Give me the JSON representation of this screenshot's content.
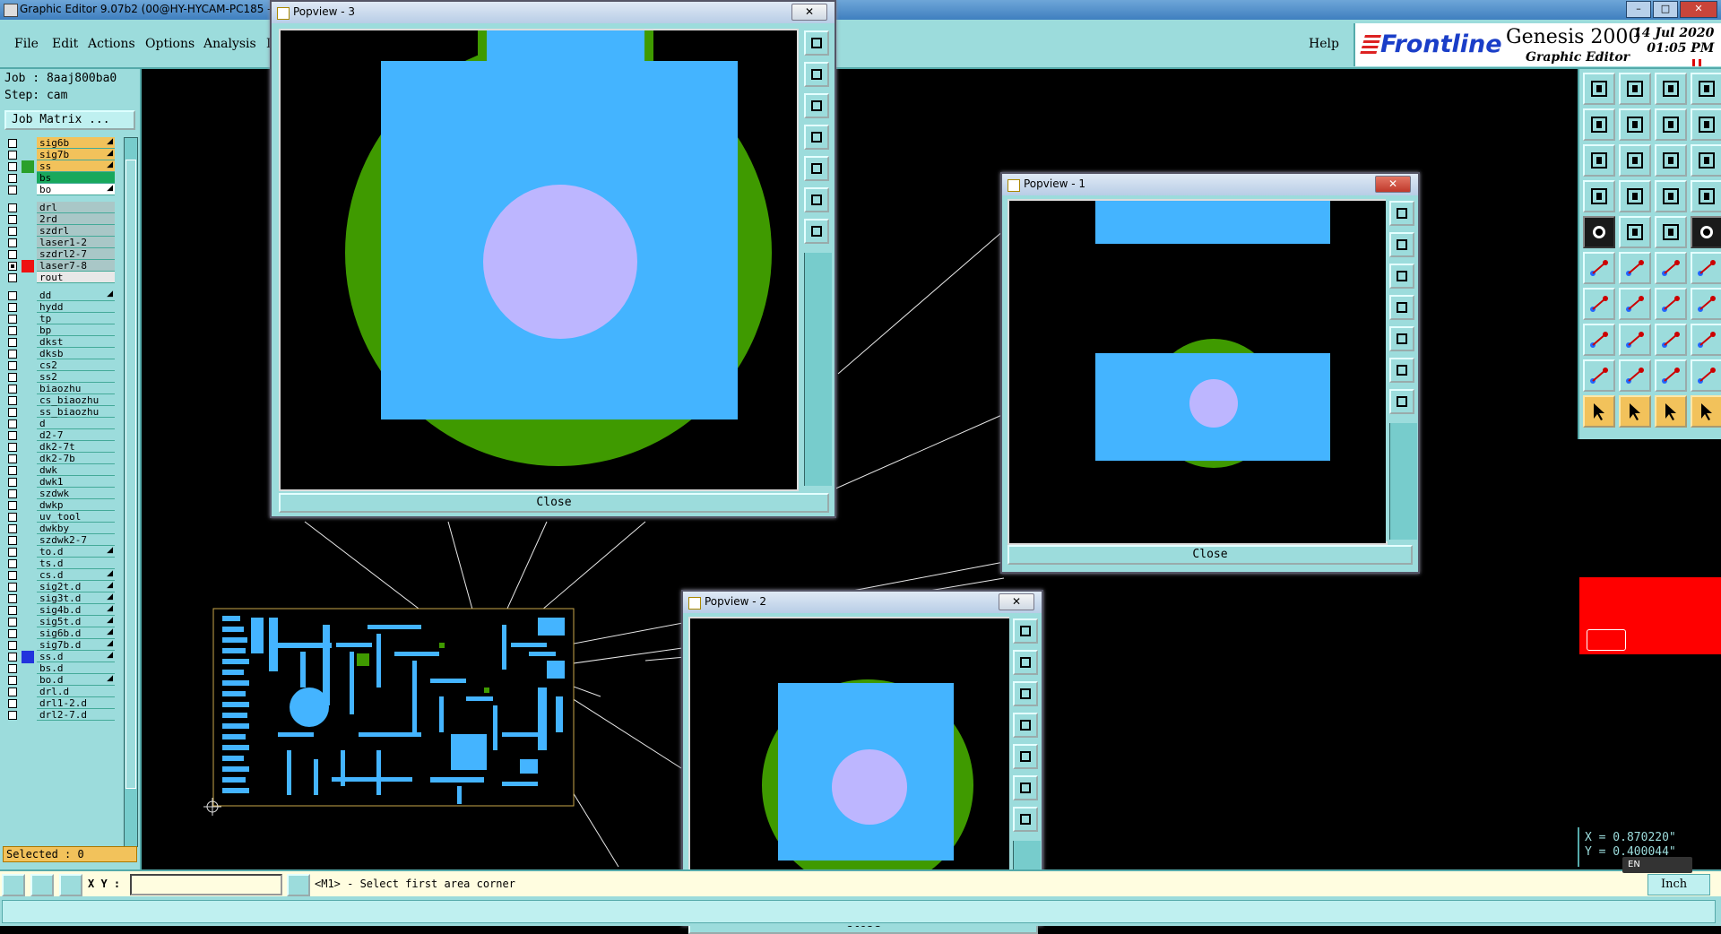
{
  "window": {
    "title": "Graphic Editor 9.07b2 (00@HY-HYCAM-PC185 - ",
    "minimize_glyph": "–",
    "maximize_glyph": "□",
    "close_glyph": "✕"
  },
  "menu": {
    "items": [
      "File",
      "Edit",
      "Actions",
      "Options",
      "Analysis",
      "I"
    ],
    "help": "Help"
  },
  "brand": {
    "frontline": "Frontline",
    "product": "Genesis 2000",
    "subtitle": "Graphic Editor",
    "date": "14 Jul 2020",
    "time": "01:05 PM"
  },
  "job": {
    "job_line": "Job : 8aaj800ba0",
    "step_line": "Step: cam",
    "matrix_button": "Job Matrix ...",
    "selected": "Selected : 0"
  },
  "layers": [
    {
      "name": "sig6b",
      "bg": "#f2c25b",
      "swatch": "",
      "checked": false,
      "arrow": true
    },
    {
      "name": "sig7b",
      "bg": "#f2c25b",
      "swatch": "",
      "checked": false,
      "arrow": true
    },
    {
      "name": "ss",
      "bg": "#f2c25b",
      "swatch": "#2aa02a",
      "checked": false,
      "arrow": true
    },
    {
      "name": "bs",
      "bg": "#19a85c",
      "swatch": "",
      "checked": false,
      "arrow": false
    },
    {
      "name": "bo",
      "bg": "#ffffff",
      "swatch": "",
      "checked": false,
      "arrow": true
    },
    {
      "name": "drl",
      "bg": "#a9c7c7",
      "swatch": "",
      "checked": false,
      "arrow": false,
      "gap": true
    },
    {
      "name": "2rd",
      "bg": "#a9c7c7",
      "swatch": "",
      "checked": false,
      "arrow": false
    },
    {
      "name": "szdrl",
      "bg": "#a9c7c7",
      "swatch": "",
      "checked": false,
      "arrow": false
    },
    {
      "name": "laser1-2",
      "bg": "#a9c7c7",
      "swatch": "",
      "checked": false,
      "arrow": false
    },
    {
      "name": "szdrl2-7",
      "bg": "#a9c7c7",
      "swatch": "",
      "checked": false,
      "arrow": false
    },
    {
      "name": "laser7-8",
      "bg": "#a9c7c7",
      "swatch": "#ee1111",
      "checked": true,
      "arrow": false
    },
    {
      "name": "rout",
      "bg": "#e8e8e8",
      "swatch": "",
      "checked": false,
      "arrow": false
    },
    {
      "name": "dd",
      "bg": "#9cdcdc",
      "swatch": "",
      "checked": false,
      "arrow": true,
      "gap": true
    },
    {
      "name": "hydd",
      "bg": "#9cdcdc",
      "swatch": "",
      "checked": false,
      "arrow": false
    },
    {
      "name": "tp",
      "bg": "#9cdcdc",
      "swatch": "",
      "checked": false,
      "arrow": false
    },
    {
      "name": "bp",
      "bg": "#9cdcdc",
      "swatch": "",
      "checked": false,
      "arrow": false
    },
    {
      "name": "dkst",
      "bg": "#9cdcdc",
      "swatch": "",
      "checked": false,
      "arrow": false
    },
    {
      "name": "dksb",
      "bg": "#9cdcdc",
      "swatch": "",
      "checked": false,
      "arrow": false
    },
    {
      "name": "cs2",
      "bg": "#9cdcdc",
      "swatch": "",
      "checked": false,
      "arrow": false
    },
    {
      "name": "ss2",
      "bg": "#9cdcdc",
      "swatch": "",
      "checked": false,
      "arrow": false
    },
    {
      "name": "biaozhu",
      "bg": "#9cdcdc",
      "swatch": "",
      "checked": false,
      "arrow": false
    },
    {
      "name": "cs_biaozhu",
      "bg": "#9cdcdc",
      "swatch": "",
      "checked": false,
      "arrow": false
    },
    {
      "name": "ss_biaozhu",
      "bg": "#9cdcdc",
      "swatch": "",
      "checked": false,
      "arrow": false
    },
    {
      "name": "d",
      "bg": "#9cdcdc",
      "swatch": "",
      "checked": false,
      "arrow": false
    },
    {
      "name": "d2-7",
      "bg": "#9cdcdc",
      "swatch": "",
      "checked": false,
      "arrow": false
    },
    {
      "name": "dk2-7t",
      "bg": "#9cdcdc",
      "swatch": "",
      "checked": false,
      "arrow": false
    },
    {
      "name": "dk2-7b",
      "bg": "#9cdcdc",
      "swatch": "",
      "checked": false,
      "arrow": false
    },
    {
      "name": "dwk",
      "bg": "#9cdcdc",
      "swatch": "",
      "checked": false,
      "arrow": false
    },
    {
      "name": "dwk1",
      "bg": "#9cdcdc",
      "swatch": "",
      "checked": false,
      "arrow": false
    },
    {
      "name": "szdwk",
      "bg": "#9cdcdc",
      "swatch": "",
      "checked": false,
      "arrow": false
    },
    {
      "name": "dwkp",
      "bg": "#9cdcdc",
      "swatch": "",
      "checked": false,
      "arrow": false
    },
    {
      "name": "uv_tool",
      "bg": "#9cdcdc",
      "swatch": "",
      "checked": false,
      "arrow": false
    },
    {
      "name": "dwkby",
      "bg": "#9cdcdc",
      "swatch": "",
      "checked": false,
      "arrow": false
    },
    {
      "name": "szdwk2-7",
      "bg": "#9cdcdc",
      "swatch": "",
      "checked": false,
      "arrow": false
    },
    {
      "name": "to.d",
      "bg": "#9cdcdc",
      "swatch": "",
      "checked": false,
      "arrow": true
    },
    {
      "name": "ts.d",
      "bg": "#9cdcdc",
      "swatch": "",
      "checked": false,
      "arrow": false
    },
    {
      "name": "cs.d",
      "bg": "#9cdcdc",
      "swatch": "",
      "checked": false,
      "arrow": true
    },
    {
      "name": "sig2t.d",
      "bg": "#9cdcdc",
      "swatch": "",
      "checked": false,
      "arrow": true
    },
    {
      "name": "sig3t.d",
      "bg": "#9cdcdc",
      "swatch": "",
      "checked": false,
      "arrow": true
    },
    {
      "name": "sig4b.d",
      "bg": "#9cdcdc",
      "swatch": "",
      "checked": false,
      "arrow": true
    },
    {
      "name": "sig5t.d",
      "bg": "#9cdcdc",
      "swatch": "",
      "checked": false,
      "arrow": true
    },
    {
      "name": "sig6b.d",
      "bg": "#9cdcdc",
      "swatch": "",
      "checked": false,
      "arrow": true
    },
    {
      "name": "sig7b.d",
      "bg": "#9cdcdc",
      "swatch": "",
      "checked": false,
      "arrow": true
    },
    {
      "name": "ss.d",
      "bg": "#9cdcdc",
      "swatch": "#2233dd",
      "checked": false,
      "arrow": true
    },
    {
      "name": "bs.d",
      "bg": "#9cdcdc",
      "swatch": "",
      "checked": false,
      "arrow": false
    },
    {
      "name": "bo.d",
      "bg": "#9cdcdc",
      "swatch": "",
      "checked": false,
      "arrow": true
    },
    {
      "name": "drl.d",
      "bg": "#9cdcdc",
      "swatch": "",
      "checked": false,
      "arrow": false
    },
    {
      "name": "drl1-2.d",
      "bg": "#9cdcdc",
      "swatch": "",
      "checked": false,
      "arrow": false
    },
    {
      "name": "drl2-7.d",
      "bg": "#9cdcdc",
      "swatch": "",
      "checked": false,
      "arrow": false
    }
  ],
  "popups": {
    "p3": {
      "title": "Popview - 3",
      "close": "Close"
    },
    "p1": {
      "title": "Popview - 1",
      "close": "Close"
    },
    "p2": {
      "title": "Popview - 2",
      "close": "Close"
    }
  },
  "status": {
    "xy_label": "X Y :",
    "xy_value": "",
    "prompt": "<M1> - Select first area corner",
    "units": "Inch",
    "lang": "EN"
  },
  "coords": {
    "x": "X = 0.870220\"",
    "y": "Y = 0.400044\""
  },
  "colors": {
    "panel": "#9cdcdc",
    "copper": "#44b4ff",
    "mask": "#3f9a00",
    "drill": "#bdb6ff",
    "highlight": "#f2c25b"
  }
}
